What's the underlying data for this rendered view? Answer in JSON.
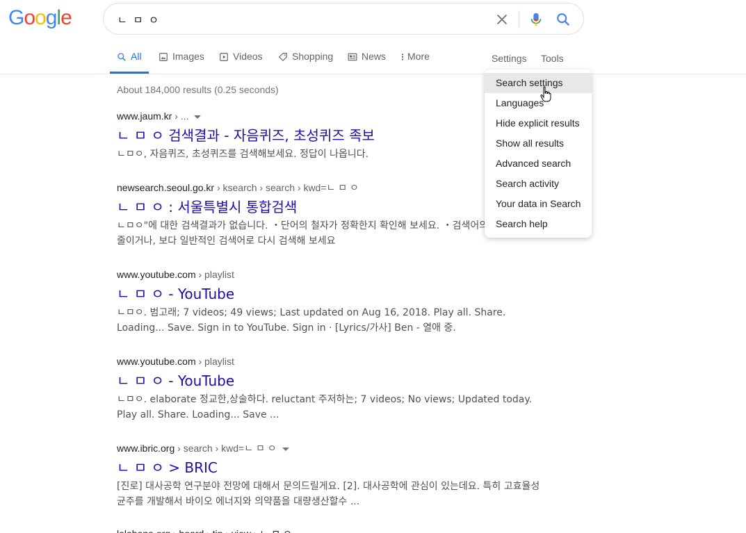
{
  "logo": {
    "letters": [
      "G",
      "o",
      "o",
      "g",
      "l",
      "e"
    ],
    "colors": [
      "#4285f4",
      "#ea4335",
      "#fbbc05",
      "#4285f4",
      "#34a853",
      "#ea4335"
    ]
  },
  "search": {
    "query": "ㄴ ㅁ ㅇ"
  },
  "tabs": [
    {
      "label": "All",
      "icon": "search-icon",
      "active": true
    },
    {
      "label": "Images",
      "icon": "image-icon"
    },
    {
      "label": "Videos",
      "icon": "video-icon"
    },
    {
      "label": "Shopping",
      "icon": "tag-icon"
    },
    {
      "label": "News",
      "icon": "news-icon"
    },
    {
      "label": "More",
      "icon": "more-vert-icon"
    }
  ],
  "tools": {
    "settings": "Settings",
    "tools": "Tools"
  },
  "stats": "About 184,000 results (0.25 seconds)",
  "results": [
    {
      "domain": "www.jaum.kr",
      "path": " › ...",
      "caret": true,
      "title": "ㄴ ㅁ ㅇ 검색결과 - 자음퀴즈, 초성퀴즈 족보",
      "snippet": "ㄴㅁㅇ, 자음퀴즈, 초성퀴즈를 검색해보세요. 정답이 나옵니다."
    },
    {
      "domain": "newsearch.seoul.go.kr",
      "path": " › ksearch › search › kwd=ㄴ ㅁ ㅇ",
      "caret": false,
      "title": "ㄴ ㅁ ㅇ : 서울특별시 통합검색",
      "snippet": "ㄴㅁㅇ\"에 대한 검색결과가 없습니다. ・단어의 철자가 정확한지 확인해 보세요. ・검색어의 단어 수를 줄이거나, 보다 일반적인 검색어로 다시 검색해 보세요"
    },
    {
      "domain": "www.youtube.com",
      "path": " › playlist",
      "caret": false,
      "title": "ㄴ ㅁ ㅇ - YouTube",
      "snippet": "ㄴㅁㅇ. 범고래; 7 videos; 49 views; Last updated on Aug 16, 2018. Play all. Share. Loading... Save. Sign in to YouTube. Sign in · [Lyrics/가사] Ben - 열애 중."
    },
    {
      "domain": "www.youtube.com",
      "path": " › playlist",
      "caret": false,
      "title": "ㄴ ㅁ ㅇ - YouTube",
      "snippet": "ㄴㅁㅇ. elaborate 정교한,상술하다. reluctant 주저하는; 7 videos; No views; Updated today. Play all. Share. Loading... Save ..."
    },
    {
      "domain": "www.ibric.org",
      "path": " › search › kwd=ㄴ ㅁ ㅇ",
      "caret": true,
      "title": "ㄴ ㅁ ㅇ > BRIC",
      "snippet": "[진로] 대사공학 연구분야 전망에 대해서 문의드릴게요. [2]. 대사공학에 관심이 있는데요. 특히 고효율성 균주를 개발해서 바이오 에너지와 의약품을 대량생산할수 ..."
    }
  ],
  "cutoff": "lalahana.org › board › tip › view › ㄴ ㅁ ㅇ",
  "menu": {
    "items": [
      "Search settings",
      "Languages",
      "Hide explicit results",
      "Show all results",
      "Advanced search",
      "Search activity",
      "Your data in Search",
      "Search help"
    ],
    "hovered": 0
  }
}
